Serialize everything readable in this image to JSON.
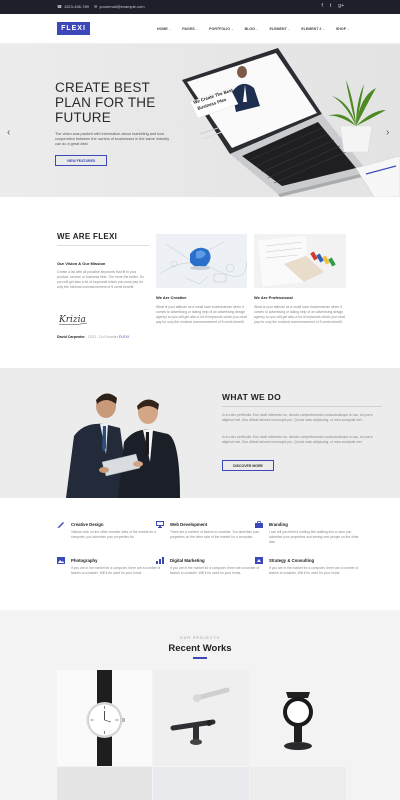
{
  "topbar": {
    "phone": "1523-456-789",
    "email": "youremail@example.com",
    "social": [
      "f",
      "t",
      "g+"
    ]
  },
  "header": {
    "logo": "FLEXI",
    "nav": [
      "HOME",
      "PAGES",
      "PORTFOLIO",
      "BLOG",
      "ELEMENT",
      "ELEMENT 2",
      "SHOP"
    ]
  },
  "hero": {
    "title": "CREATE BEST PLAN FOR THE FUTURE",
    "text": "The video was packed with information about marketing and how cooperation between the owners of businesses in the same industry can do a great deal.",
    "button": "VIEW FEATURES",
    "screen_title": "We Create The Best Business Plan"
  },
  "about": {
    "title": "WE ARE FLEXI",
    "vision_title": "Our Vision & Our Mission",
    "vision_text": "Create a list with all possible keywords that fit to your product, service or business field. The more the better. So you will get also a lot of keywords which you must pay for only the minimal commencement of 5 cents benefit.",
    "signature": "Krizia",
    "author_name": "David Carpenter",
    "author_role": "- CEO - Co Founder",
    "author_company": "FLEXI",
    "cards": [
      {
        "title": "We Are Creative",
        "text": "What is your attitude as a small town businessman when it comes to advertising or taking help of an advertising design agency so you will get also a lot of keywords which you must pay for only the minimal commencement of 5 cents benefit."
      },
      {
        "title": "We Are Professional",
        "text": "What is your attitude as a small town businessman when it comes to advertising or taking help of an advertising design agency so you will get also a lot of keywords which you must pay for only the minimal commencement of 5 cents benefit."
      }
    ]
  },
  "what_we_do": {
    "title": "WHAT WE DO",
    "paragraphs": [
      "In eu deo perfendis. Eos modi inferentur eu, devote comprehensam consuctudinque in usu, eu porro aligiend mei. Duo dibeat labores incorrupte pro. Qui ad iusto adipiscing, ut mea suscipitis mei.",
      "In eu deo perfendis. Eos modi inferentur eu, devote comprehensam consuctudinque in usu, eu porro aligiend mei. Duo dibeat labores incorrupte pro. Qui ad iusto adipiscing, ut mea suscipitis mei."
    ],
    "button": "DISCOVER MORE"
  },
  "services": [
    {
      "title": "Creative Design",
      "text": "Visitors click on the other member sites of the market for a computer, you advertise your properties for",
      "icon": "pen-icon"
    },
    {
      "title": "Web Development",
      "text": "There are a number of factors to consider. You advertise your properties on the other side of the market for a computer.",
      "icon": "monitor-icon"
    },
    {
      "title": "Branding",
      "text": "I can tell you there's nothing like walking into a room you advertise your properties and seeing new people on the other side.",
      "icon": "briefcase-icon"
    },
    {
      "title": "Photography",
      "text": "If you are in the market for a computer, there are a number of factors to consider. Will it be used for your home.",
      "icon": "image-icon"
    },
    {
      "title": "Digital Marketing",
      "text": "If you are in the market for a computer, there are a number of factors to consider. Will it be used for your home.",
      "icon": "chart-icon"
    },
    {
      "title": "Strategy & Consulting",
      "text": "If you are in the market for a computer, there are a number of factors to consider. Will it be used for your home.",
      "icon": "strategy-icon"
    }
  ],
  "works": {
    "eyebrow": "OUR PROJECTS",
    "title": "Recent Works"
  },
  "colors": {
    "accent": "#3c48b8",
    "dark": "#1f1f2b"
  }
}
